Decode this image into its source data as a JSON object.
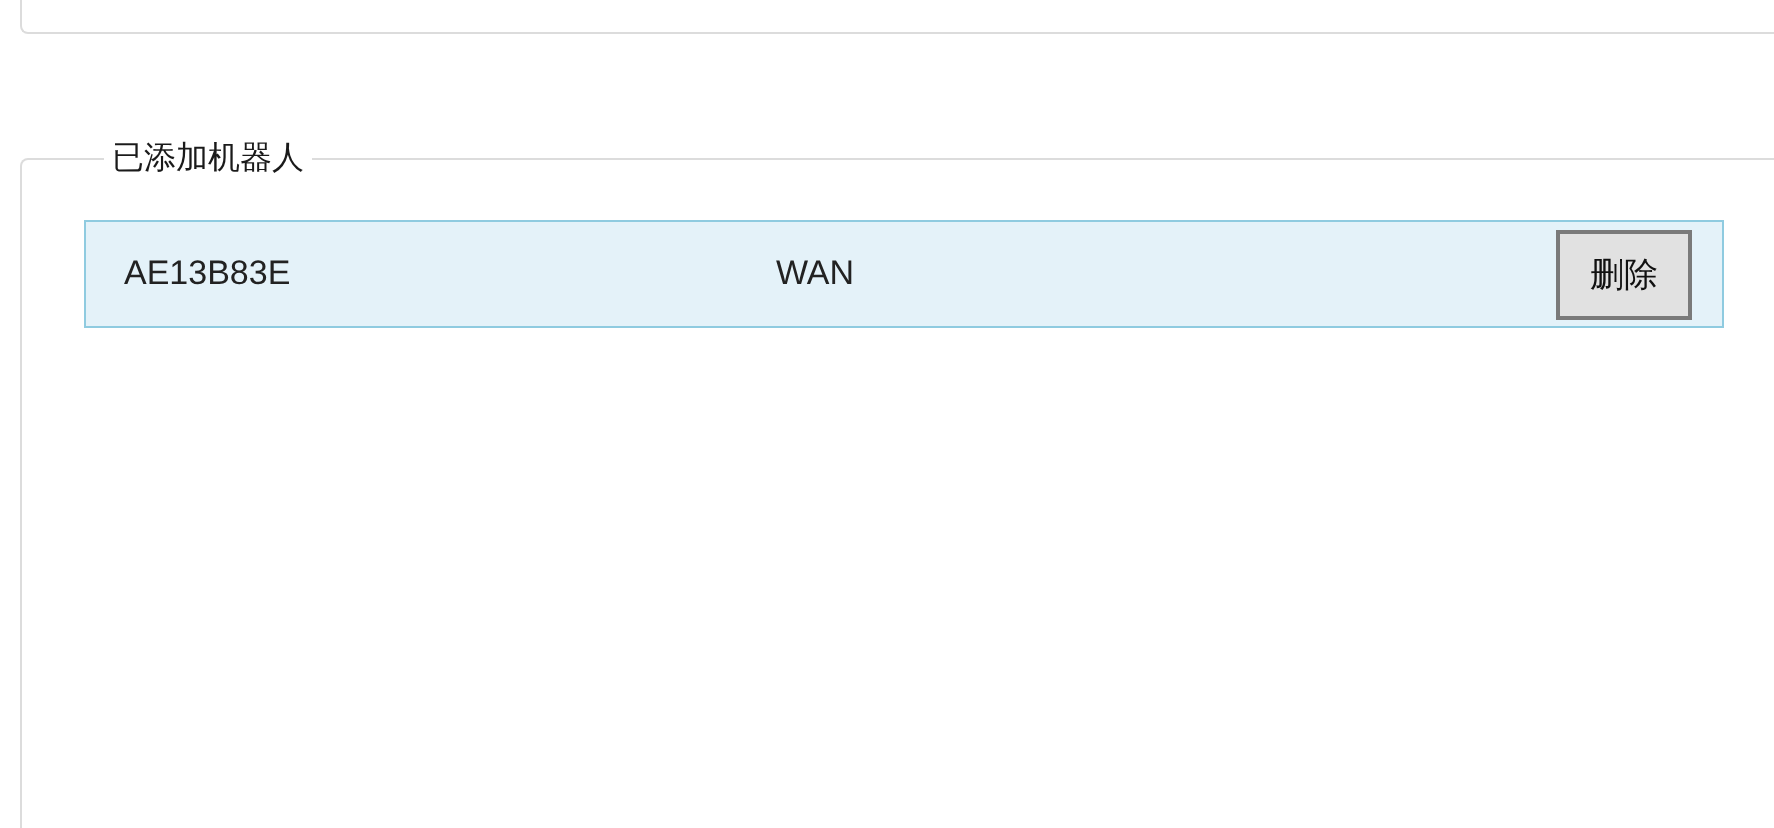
{
  "group": {
    "title": "已添加机器人",
    "robots": [
      {
        "id": "AE13B83E",
        "network": "WAN",
        "delete_button": "删除"
      }
    ]
  }
}
